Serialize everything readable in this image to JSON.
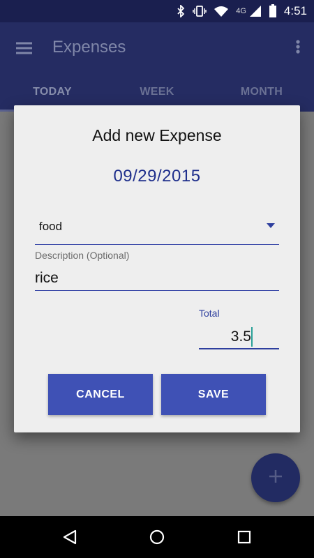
{
  "status_bar": {
    "time": "4:51",
    "network": "4G",
    "icons": [
      "bluetooth-icon",
      "vibrate-icon",
      "wifi-icon",
      "signal-icon",
      "battery-icon"
    ]
  },
  "app_bar": {
    "title": "Expenses",
    "menu_icon": "menu-icon",
    "overflow_icon": "more-vert-icon",
    "tabs": [
      {
        "label": "TODAY",
        "active": true
      },
      {
        "label": "WEEK",
        "active": false
      },
      {
        "label": "MONTH",
        "active": false
      }
    ]
  },
  "dialog": {
    "title": "Add new Expense",
    "date": "09/29/2015",
    "category": {
      "selected": "food"
    },
    "description": {
      "label": "Description (Optional)",
      "value": "rice"
    },
    "total": {
      "label": "Total",
      "value": "3.5"
    },
    "buttons": {
      "cancel": "CANCEL",
      "save": "SAVE"
    }
  },
  "fab": {
    "icon": "add-icon"
  },
  "nav_bar": {
    "icons": [
      "back-icon",
      "home-icon",
      "recents-icon"
    ]
  },
  "colors": {
    "primary": "#3f51b5",
    "primary_dark": "#1a1f4f",
    "accent_text": "#1f2f8c",
    "dialog_bg": "#eeeeee",
    "scrim": "#7a7a7a"
  }
}
